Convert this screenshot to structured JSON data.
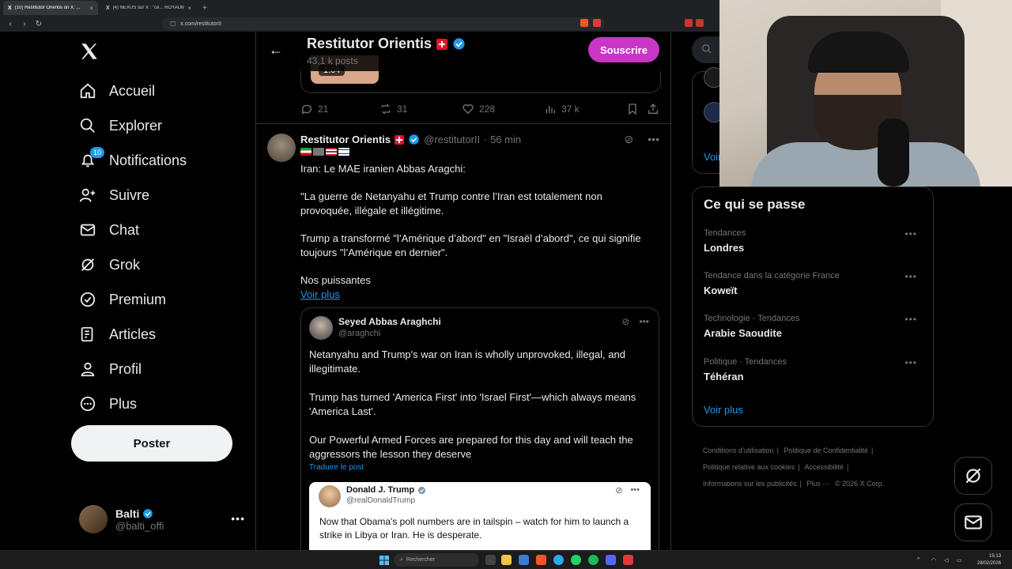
{
  "browser": {
    "tabs": [
      {
        "label": "(10) Restitutor Orientis on X: ...",
        "active": true
      },
      {
        "label": "(4) NEXUS sur X : \"ce... ROYAUME...",
        "active": false
      }
    ],
    "url": "x.com/restitutorII"
  },
  "nav": {
    "items": [
      {
        "key": "home",
        "label": "Accueil",
        "icon": "home-icon"
      },
      {
        "key": "explore",
        "label": "Explorer",
        "icon": "search-icon"
      },
      {
        "key": "notifications",
        "label": "Notifications",
        "icon": "bell-icon",
        "badge": "10"
      },
      {
        "key": "follow",
        "label": "Suivre",
        "icon": "person-plus-icon"
      },
      {
        "key": "chat",
        "label": "Chat",
        "icon": "envelope-icon"
      },
      {
        "key": "grok",
        "label": "Grok",
        "icon": "grok-icon"
      },
      {
        "key": "premium",
        "label": "Premium",
        "icon": "verified-icon"
      },
      {
        "key": "articles",
        "label": "Articles",
        "icon": "article-icon"
      },
      {
        "key": "profile",
        "label": "Profil",
        "icon": "person-icon"
      },
      {
        "key": "more",
        "label": "Plus",
        "icon": "more-circle-icon"
      }
    ],
    "post_label": "Poster",
    "user": {
      "name": "Balti",
      "handle": "@balti_offi"
    }
  },
  "header": {
    "title": "Restitutor Orientis",
    "posts": "43,1 k posts",
    "subscribe": "Souscrire"
  },
  "prev_tweet": {
    "duration": "1:04",
    "replies": "21",
    "reposts": "31",
    "likes": "228",
    "views": "37 k"
  },
  "tweet": {
    "name": "Restitutor Orientis",
    "handle": "@restitutorII",
    "time": "· 56 min",
    "p1": "Iran: Le MAE iranien Abbas Aragchi:",
    "p2": "\"La guerre de Netanyahu et Trump contre l’Iran est totalement non provoquée, illégale et illégitime.",
    "p3": "Trump a transformé \"l’Amérique d’abord\" en \"Israël d’abord\", ce qui signifie toujours \"l’Amérique en dernier\".",
    "p4": "Nos puissantes",
    "see_more": "Voir plus"
  },
  "quote": {
    "name": "Seyed Abbas Araghchi",
    "handle": "@araghchi",
    "p1": "Netanyahu and Trump's war on Iran is wholly unprovoked, illegal, and illegitimate.",
    "p2": "Trump has turned 'America First' into 'Israel First'—which always means 'America Last'.",
    "p3": "Our Powerful Armed Forces are prepared for this day and will teach the aggressors the lesson they deserve",
    "translate": "Traduire le post",
    "inner": {
      "name": "Donald J. Trump",
      "handle": "@realDonaldTrump",
      "text": "Now that Obama's poll numbers are in tailspin – watch for him to launch a strike in Libya or Iran.  He is desperate."
    }
  },
  "sidebar": {
    "who_to_follow_more": "Voir",
    "trends_title": "Ce qui se passe",
    "trends": [
      {
        "meta": "Tendances",
        "name": "Londres"
      },
      {
        "meta": "Tendance dans la catégorie France",
        "name": "Koweït"
      },
      {
        "meta": "Technologie · Tendances",
        "name": "Arabie Saoudite"
      },
      {
        "meta": "Politique · Tendances",
        "name": "Téhéran"
      }
    ],
    "see_more": "Voir plus",
    "footer": [
      "Conditions d’utilisation",
      "|",
      "Politique de Confidentialité",
      "|",
      "Politique relative aux cookies",
      "|",
      "Accessibilité",
      "|",
      "Informations sur les publicités",
      "|",
      "Plus ···",
      "© 2026 X Corp."
    ]
  },
  "taskbar": {
    "search": "Rechercher",
    "time": "15:13",
    "date": "28/02/2026"
  },
  "colors": {
    "accent": "#1d9bf0",
    "subscribe": "#c936c6",
    "background": "#000000",
    "border": "#2f3336"
  }
}
